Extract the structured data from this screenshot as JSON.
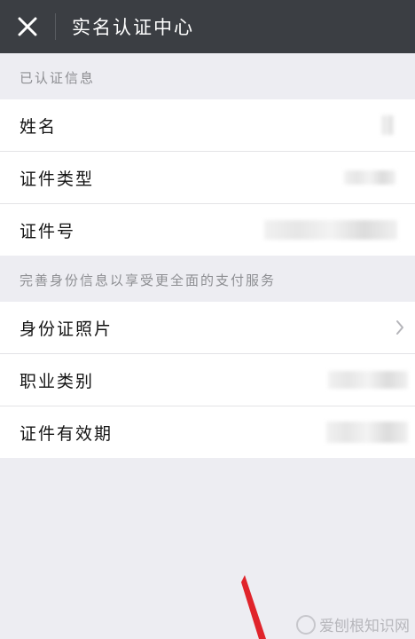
{
  "header": {
    "title": "实名认证中心",
    "close_icon": "close-icon"
  },
  "sections": [
    {
      "title": "已认证信息",
      "rows": [
        {
          "label": "姓名"
        },
        {
          "label": "证件类型"
        },
        {
          "label": "证件号"
        }
      ]
    },
    {
      "title": "完善身份信息以享受更全面的支付服务",
      "rows": [
        {
          "label": "身份证照片",
          "icon": "chevron-right-icon"
        },
        {
          "label": "职业类别"
        },
        {
          "label": "证件有效期"
        }
      ]
    }
  ],
  "watermark": {
    "text": "爱刨根知识网"
  },
  "colors": {
    "topbar": "#3b3e43",
    "background": "#ededf2",
    "arrow": "#e0242b"
  }
}
